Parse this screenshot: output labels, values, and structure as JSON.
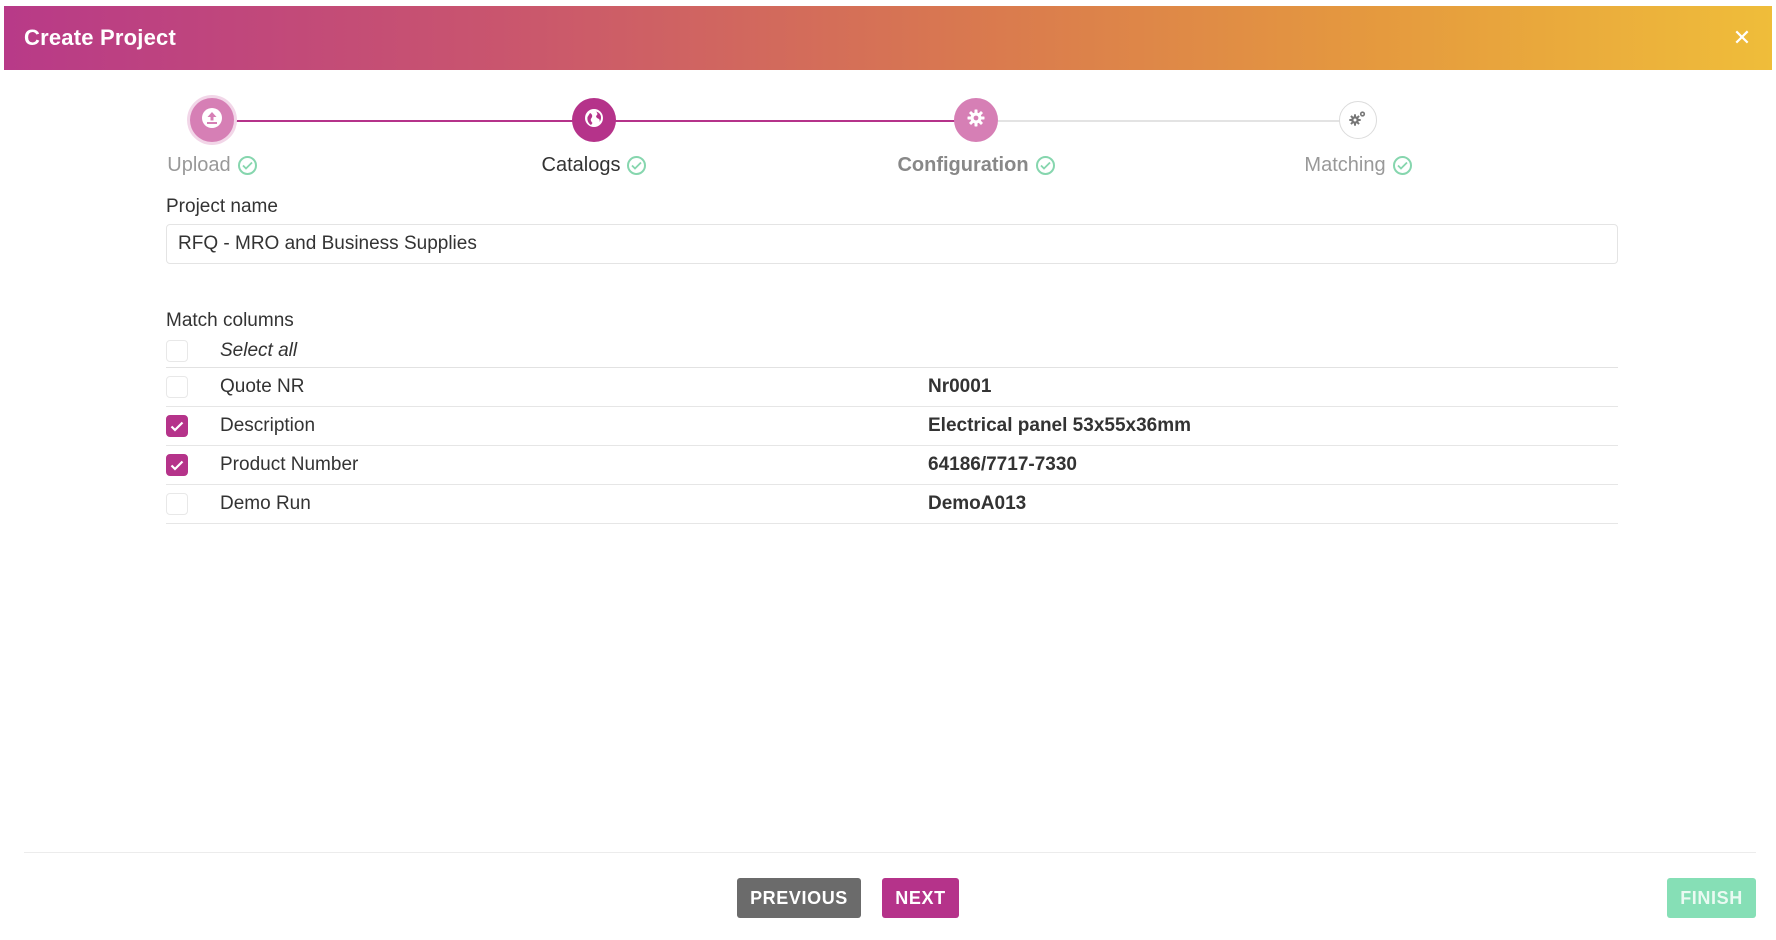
{
  "dialog": {
    "title": "Create Project",
    "close_label": "✕"
  },
  "colors": {
    "accent": "#b5338a",
    "success": "#86d6ae",
    "step_line_active": "#b5338a",
    "step_line_inactive": "#e3e3e3"
  },
  "stepper": {
    "steps": [
      {
        "label": "Upload",
        "icon": "upload-icon",
        "state": "visited",
        "completed": true
      },
      {
        "label": "Catalogs",
        "icon": "globe-icon",
        "state": "active",
        "completed": true
      },
      {
        "label": "Configuration",
        "icon": "gear-icon",
        "state": "visited",
        "completed": true
      },
      {
        "label": "Matching",
        "icon": "gears-icon",
        "state": "pending",
        "completed": true
      }
    ]
  },
  "form": {
    "project_name_label": "Project name",
    "project_name_value": "RFQ - MRO and Business Supplies",
    "match_columns_label": "Match columns",
    "select_all_label": "Select all",
    "select_all_checked": false,
    "columns": [
      {
        "name": "Quote NR",
        "value": "Nr0001",
        "checked": false
      },
      {
        "name": "Description",
        "value": "Electrical panel 53x55x36mm",
        "checked": true
      },
      {
        "name": "Product Number",
        "value": "64186/7717-7330",
        "checked": true
      },
      {
        "name": "Demo Run",
        "value": "DemoA013",
        "checked": false
      }
    ]
  },
  "footer": {
    "previous_label": "PREVIOUS",
    "next_label": "NEXT",
    "finish_label": "FINISH"
  }
}
